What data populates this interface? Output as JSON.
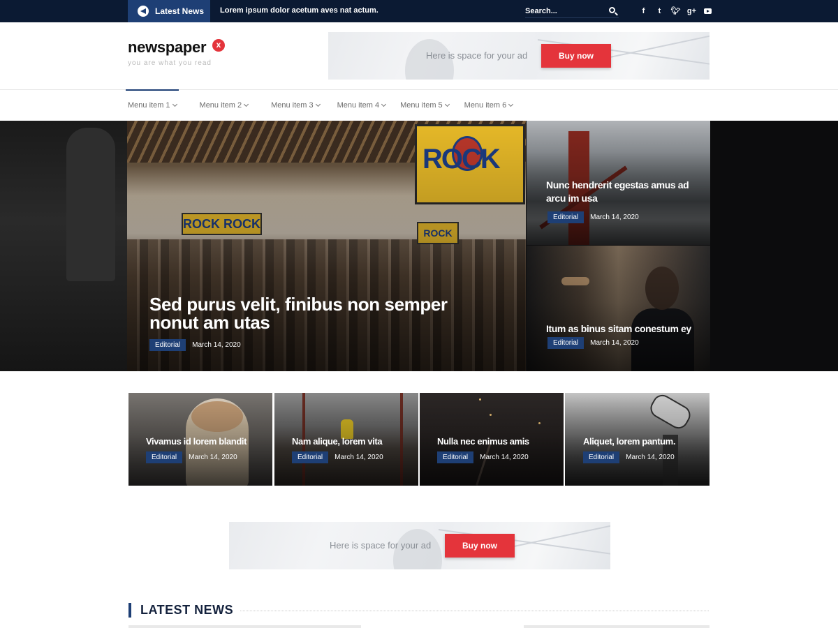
{
  "topbar": {
    "latest_label": "Latest News",
    "ticker_text": "Lorem ipsum dolor acetum aves nat actum.",
    "search_placeholder": "Search...",
    "social": [
      "f",
      "t",
      "𝕥",
      "g+"
    ]
  },
  "header": {
    "logo_text": "newspaper",
    "logo_mark": "x",
    "tagline": "you are what you read",
    "ad_text": "Here is space for your ad",
    "ad_button": "Buy now"
  },
  "nav": {
    "items": [
      "Menu item 1",
      "Menu item 2",
      "Menu item 3",
      "Menu item 4",
      "Menu item 5",
      "Menu item 6"
    ],
    "active_index": 0
  },
  "hero": {
    "main": {
      "title_line1": "Sed purus velit, finibus non semper",
      "title_line2": "nonut am utas",
      "category": "Editorial",
      "date": "March 14, 2020"
    },
    "side1": {
      "title_line1": "Nunc hendrerit egestas amus ad",
      "title_line2": "arcu im usa",
      "category": "Editorial",
      "date": "March 14, 2020"
    },
    "side2": {
      "title_line1": "Itum as binus sitam conestum ey",
      "category": "Editorial",
      "date": "March 14, 2020"
    }
  },
  "grid": [
    {
      "title": "Vivamus id lorem blandit",
      "category": "Editorial",
      "date": "March 14, 2020"
    },
    {
      "title": "Nam alique, lorem vita",
      "category": "Editorial",
      "date": "March 14, 2020"
    },
    {
      "title": "Nulla nec enimus amis",
      "category": "Editorial",
      "date": "March 14, 2020"
    },
    {
      "title": "Aliquet, lorem pantum.",
      "category": "Editorial",
      "date": "March 14, 2020"
    }
  ],
  "ad2": {
    "text": "Here is space for your ad",
    "button": "Buy now"
  },
  "latest": {
    "title": "LATEST NEWS"
  },
  "colors": {
    "topbar": "#0b1a33",
    "accent": "#1e3f75",
    "button_red": "#e4343b"
  }
}
